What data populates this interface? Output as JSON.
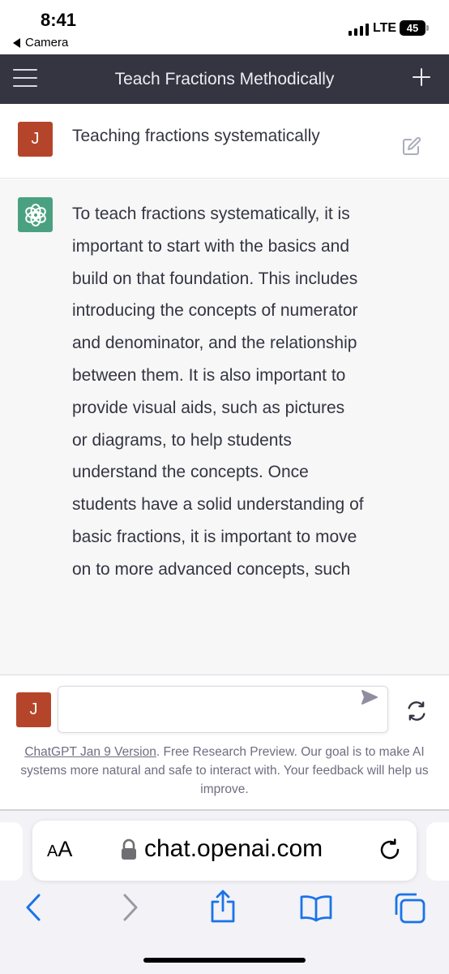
{
  "status_bar": {
    "time": "8:41",
    "back_app": "Camera",
    "network": "LTE",
    "battery": "45"
  },
  "nav": {
    "title": "Teach Fractions Methodically",
    "menu_icon": "hamburger-icon",
    "new_chat_icon": "plus-icon"
  },
  "user_message": {
    "avatar": "J",
    "text": "Teaching fractions systematically",
    "edit_icon": "edit-icon"
  },
  "assistant_message": {
    "logo_icon": "openai-logo-icon",
    "text": "To teach fractions systematically, it is important to start with the basics and build on that foundation. This includes introducing the concepts of numerator and denominator, and the relationship between them. It is also important to provide visual aids, such as pictures or diagrams, to help students understand the concepts. Once students have a solid understanding of basic fractions, it is important to move on to more advanced concepts, such"
  },
  "composer": {
    "avatar": "J",
    "input_value": "",
    "send_icon": "send-icon",
    "regenerate_icon": "regenerate-icon"
  },
  "disclaimer": {
    "version_link": "ChatGPT Jan 9 Version",
    "text": ". Free Research Preview. Our goal is to make AI systems more natural and safe to interact with. Your feedback will help us improve."
  },
  "browser": {
    "text_size_label": "AA",
    "url": "chat.openai.com",
    "toolbar_icons": [
      "back-icon",
      "forward-icon",
      "share-icon",
      "bookmarks-icon",
      "tabs-icon"
    ]
  },
  "colors": {
    "nav_bg": "#343541",
    "avatar_user": "#b5452a",
    "avatar_assistant": "#4aa181",
    "assistant_bg": "#f7f7f8",
    "safari_blue": "#1a73e8"
  }
}
